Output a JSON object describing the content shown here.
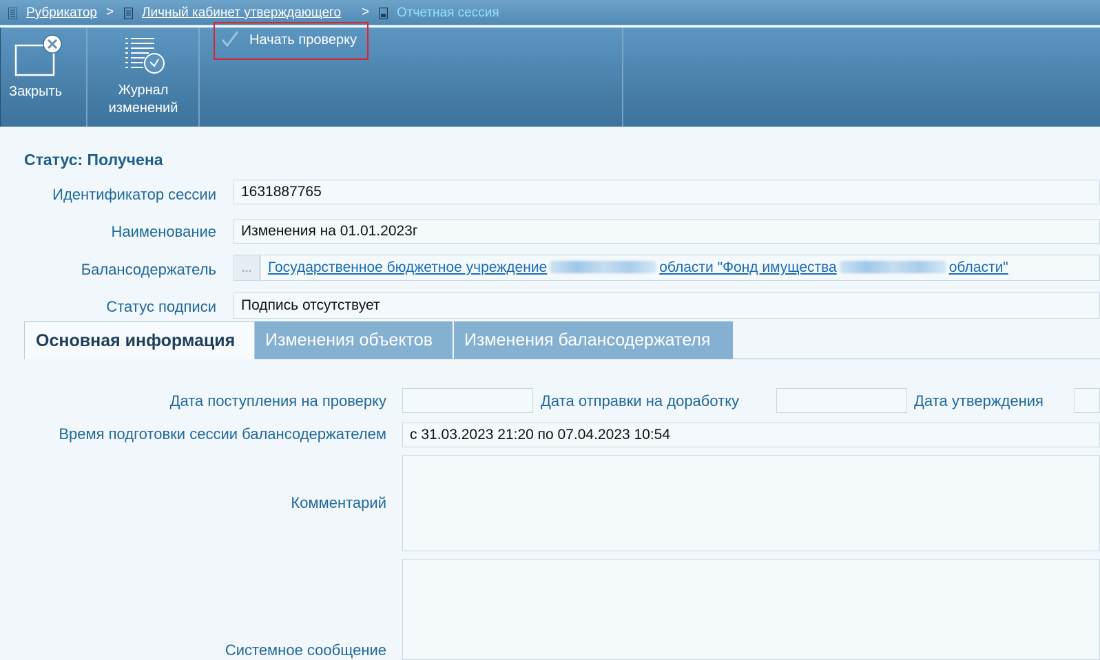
{
  "breadcrumb": {
    "items": [
      "Рубрикатор",
      "Личный кабинет утверждающего"
    ],
    "separator": ">",
    "current": "Отчетная сессия"
  },
  "toolbar": {
    "close_label": "Закрыть",
    "journal_label_1": "Журнал",
    "journal_label_2": "изменений",
    "start_check_label": "Начать проверку"
  },
  "status": {
    "title": "Статус: Получена"
  },
  "form": {
    "session_id_label": "Идентификатор сессии",
    "session_id_value": "1631887765",
    "name_label": "Наименование",
    "name_value": "Изменения на 01.01.2023г",
    "owner_label": "Балансодержатель",
    "owner_button": "...",
    "owner_part1": "Государственное бюджетное учреждение",
    "owner_part2": "области \"Фонд имущества",
    "owner_part3": "области\"",
    "sign_status_label": "Статус подписи",
    "sign_status_value": "Подпись отсутствует"
  },
  "tabs": [
    "Основная информация",
    "Изменения объектов",
    "Изменения балансодержателя"
  ],
  "main": {
    "date_received_label": "Дата поступления на проверку",
    "date_received_value": "",
    "date_sent_back_label": "Дата отправки на доработку",
    "date_sent_back_value": "",
    "date_approved_label": "Дата утверждения",
    "date_approved_value": "",
    "prep_time_label": "Время подготовки сессии балансодержателем",
    "prep_time_value": "с 31.03.2023 21:20 по 07.04.2023 10:54",
    "comment_label": "Комментарий",
    "comment_value": "",
    "system_msg_label": "Системное сообщение",
    "system_msg_value": ""
  },
  "colors": {
    "header": "#4f88b3",
    "toolbar": "#4a82ac",
    "label_blue": "#1f6a9c",
    "link": "#1c6cb4",
    "tab_inactive": "#84b0d1",
    "highlight_border": "#e0222b",
    "current_crumb": "#8fe0ff"
  }
}
